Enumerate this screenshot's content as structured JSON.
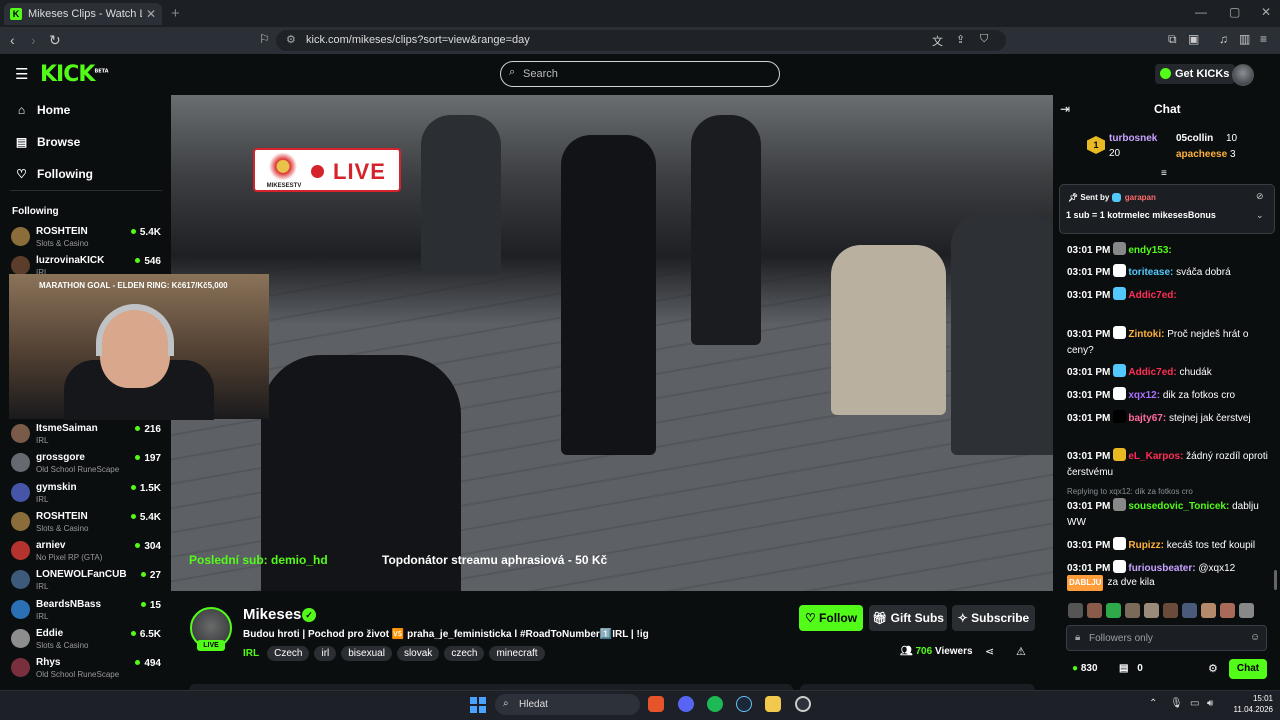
{
  "browser": {
    "tab_title": "Mikeses Clips - Watch Live on",
    "url": "kick.com/mikeses/clips?sort=view&range=day"
  },
  "header": {
    "logo": "KICK",
    "logo_sup": "BETA",
    "search_placeholder": "Search",
    "get_kicks": "Get KICKs"
  },
  "sidebar": {
    "nav": [
      {
        "label": "Home",
        "icon": "home-icon"
      },
      {
        "label": "Browse",
        "icon": "browse-icon"
      },
      {
        "label": "Following",
        "icon": "heart-icon"
      }
    ],
    "following_heading": "Following",
    "channels": [
      {
        "name": "ROSHTEIN",
        "category": "Slots & Casino",
        "viewers": "5.4K",
        "color": "#8a6d3b"
      },
      {
        "name": "luzrovinaKICK",
        "category": "IRL",
        "viewers": "546",
        "color": "#5a3d2b"
      },
      {
        "name": "ItsmeSaiman",
        "category": "IRL",
        "viewers": "216",
        "color": "#7a5a48"
      },
      {
        "name": "grossgore",
        "category": "Old School RuneScape",
        "viewers": "197",
        "color": "#666a70"
      },
      {
        "name": "gymskin",
        "category": "IRL",
        "viewers": "1.5K",
        "color": "#4655a8"
      },
      {
        "name": "ROSHTEIN",
        "category": "Slots & Casino",
        "viewers": "5.4K",
        "color": "#8a6d3b"
      },
      {
        "name": "arniev",
        "category": "No Pixel RP (GTA)",
        "viewers": "304",
        "color": "#b5332f"
      },
      {
        "name": "LONEWOLFanCUB",
        "category": "IRL",
        "viewers": "27",
        "color": "#3d5a7a"
      },
      {
        "name": "BeardsNBass",
        "category": "IRL",
        "viewers": "15",
        "color": "#2b6fb5"
      },
      {
        "name": "Eddie",
        "category": "Slots & Casino",
        "viewers": "6.5K",
        "color": "#8d8d8d"
      },
      {
        "name": "Rhys",
        "category": "Old School RuneScape",
        "viewers": "494",
        "color": "#7a2f3f"
      }
    ]
  },
  "video": {
    "live_badge_channel": "MIKESESTV",
    "live_badge_text": "LIVE",
    "goal_text": "MARATHON GOAL - ELDEN RING: Kč617/Kč5,000",
    "last_sub": "Poslední sub: demio_hd",
    "top_donor": "Topdonátor streamu aphrasiová - 50 Kč"
  },
  "stream": {
    "name": "Mikeses",
    "live_label": "LIVE",
    "title": "Budou hroti | Pochod pro život 🆚 praha_je_feministicka l #RoadToNumber1️⃣IRL | !ig",
    "category": "IRL",
    "tags": [
      "Czech",
      "irl",
      "bisexual",
      "slovak",
      "czech",
      "minecraft"
    ],
    "follow": "Follow",
    "gift_subs": "Gift Subs",
    "subscribe": "Subscribe",
    "viewers_count": "706",
    "viewers_label": "Viewers"
  },
  "chat": {
    "title": "Chat",
    "leaderboard": [
      {
        "name": "turbosnek",
        "count": "20",
        "color": "#c8a2ff"
      },
      {
        "name": "05collin",
        "count": "10",
        "color": "#ffffff"
      },
      {
        "name": "apacheese",
        "count": "3",
        "color": "#ffb13b"
      }
    ],
    "leader_rank": "1",
    "pinned_sent_by": "Sent by",
    "pinned_user": "garapan",
    "pinned_text": "1 sub = 1 kotrmelec mikesesBonus",
    "messages": [
      {
        "time": "03:01 PM",
        "user": "endy153:",
        "color": "#53fc18",
        "text": ""
      },
      {
        "time": "03:01 PM",
        "user": "toritease:",
        "color": "#53c8fc",
        "text": "sváča dobrá"
      },
      {
        "time": "03:01 PM",
        "user": "Addic7ed:",
        "color": "#ff2d55",
        "text": ""
      },
      {
        "time": "03:01 PM",
        "user": "Zintoki:",
        "color": "#ffb13b",
        "text": "Proč nejdeš hrát o ceny?"
      },
      {
        "time": "03:01 PM",
        "user": "Addic7ed:",
        "color": "#ff2d55",
        "text": "chudák"
      },
      {
        "time": "03:01 PM",
        "user": "xqx12:",
        "color": "#a970ff",
        "text": "dik za fotkos cro"
      },
      {
        "time": "03:01 PM",
        "user": "bajty67:",
        "color": "#ff6b9d",
        "text": "stejnej jak čerstvej"
      },
      {
        "time": "03:01 PM",
        "user": "eL_Karpos:",
        "color": "#ff2d55",
        "text": "žádný rozdíl oproti čerstvému"
      },
      {
        "time": "03:01 PM",
        "user": "sousedovic_Tonicek:",
        "color": "#53fc18",
        "text": "dablju WW"
      },
      {
        "time": "03:01 PM",
        "user": "Rupizz:",
        "color": "#ffb13b",
        "text": "kecáš tos teď koupil"
      },
      {
        "time": "03:01 PM",
        "user": "furiousbeater:",
        "color": "#c8a2ff",
        "text": "@xqx12"
      }
    ],
    "reply_text": "Replying to xqx12: dik za fotkos cro",
    "last_line_text": "za dve kila",
    "last_line_emote": "DABLJU",
    "input_placeholder": "Followers only",
    "points": "830",
    "gifts": "0",
    "send": "Chat"
  },
  "taskbar": {
    "search": "Hledat",
    "time": "15:01",
    "date": "11.04.2026"
  },
  "colors": {
    "accent": "#53fc18",
    "bg": "#0b0e0f"
  }
}
